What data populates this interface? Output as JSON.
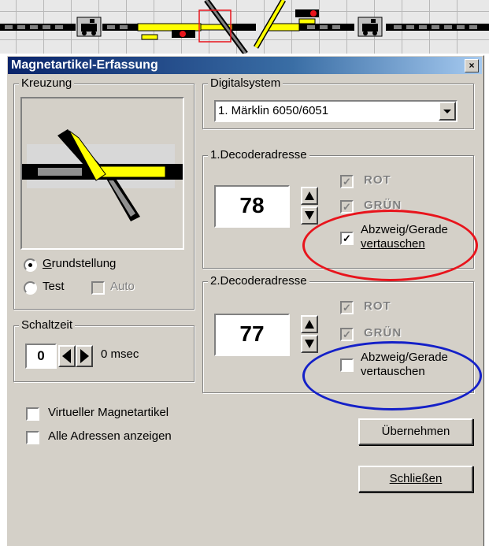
{
  "dialog": {
    "title": "Magnetartikel-Erfassung",
    "close_glyph": "×"
  },
  "kreuzung": {
    "legend": "Kreuzung",
    "radio_grundstellung": "Grundstellung",
    "radio_test": "Test",
    "auto_label": "Auto"
  },
  "schaltzeit": {
    "legend": "Schaltzeit",
    "value": "0",
    "unit": "0 msec"
  },
  "digitalsystem": {
    "legend": "Digitalsystem",
    "selected": "1. Märklin 6050/6051"
  },
  "decoder1": {
    "legend": "1.Decoderadresse",
    "address": "78",
    "rot": "ROT",
    "gruen": "GRÜN",
    "swap_line1": "Abzweig/Gerade",
    "swap_line2": "vertauschen",
    "swap_checked": true
  },
  "decoder2": {
    "legend": "2.Decoderadresse",
    "address": "77",
    "rot": "ROT",
    "gruen": "GRÜN",
    "swap_line1": "Abzweig/Gerade",
    "swap_line2": "vertauschen",
    "swap_checked": false
  },
  "options": {
    "virtual": "Virtueller Magnetartikel",
    "all_addresses": "Alle Adressen anzeigen"
  },
  "buttons": {
    "apply": "Übernehmen",
    "close": "Schließen"
  },
  "colors": {
    "highlight_red": "#e8141c",
    "highlight_blue": "#1420c8",
    "track_yellow": "#ffff00",
    "title_blue": "#0a246a"
  }
}
